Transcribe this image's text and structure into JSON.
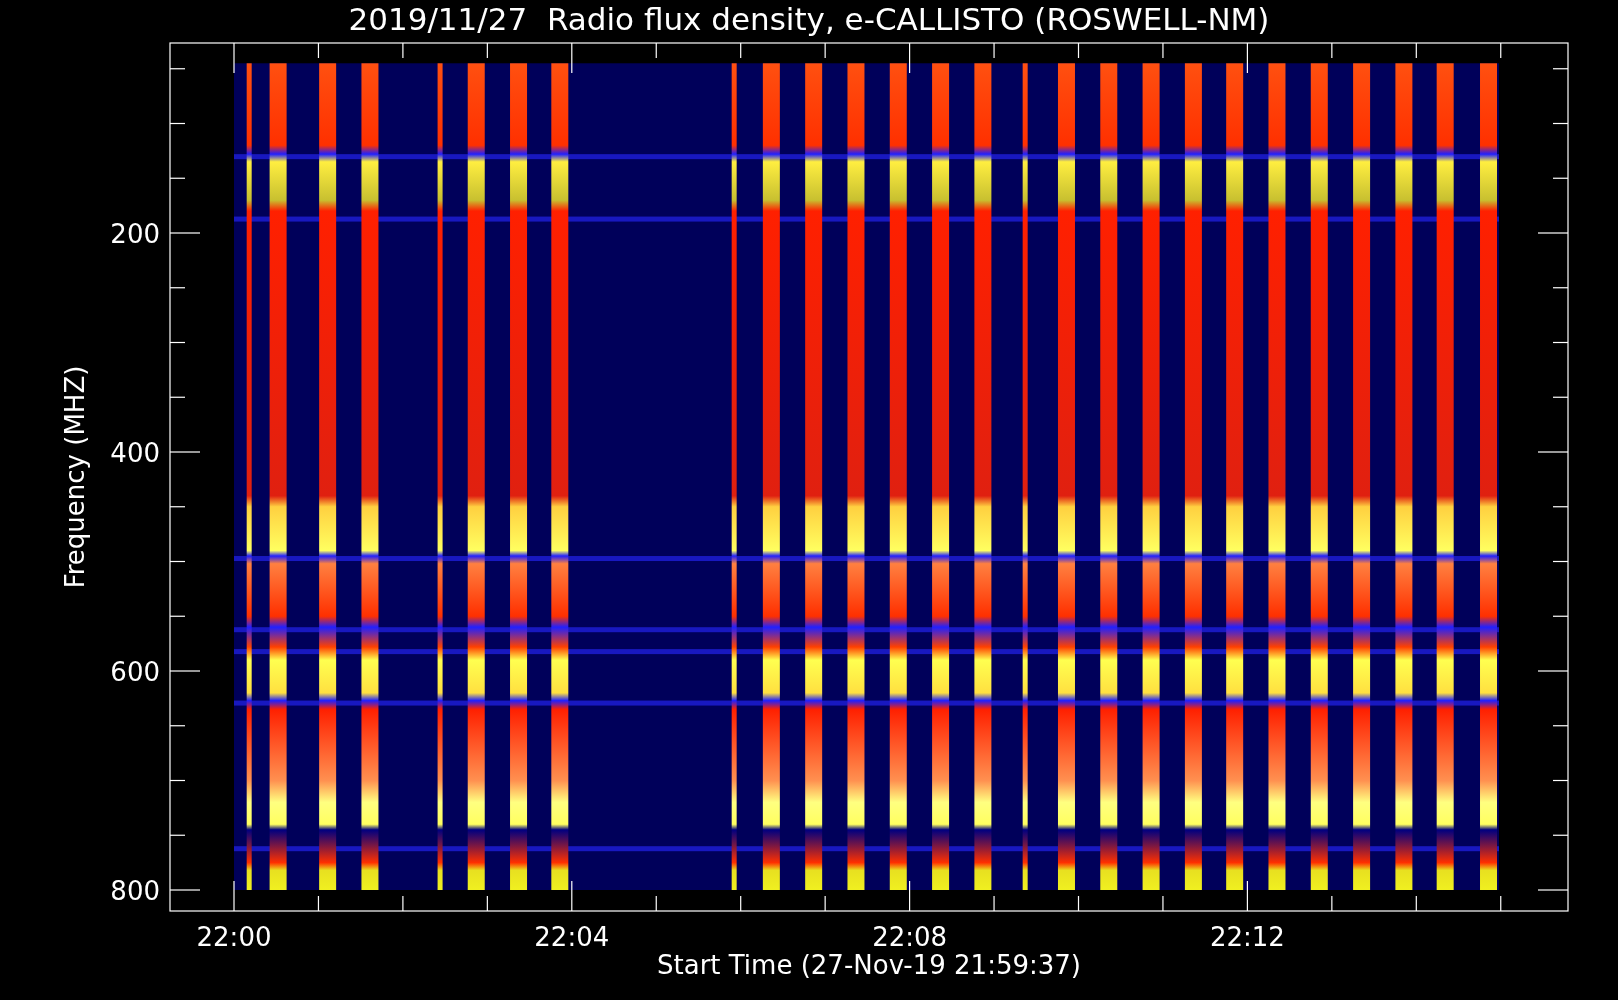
{
  "title": "2019/11/27  Radio flux density, e-CALLISTO (ROSWELL-NM)",
  "plot": {
    "ylabel": "Frequency (MHZ)",
    "xlabel": "Start Time (27-Nov-19 21:59:37)",
    "yticks": [
      "200",
      "400",
      "600",
      "800"
    ],
    "xticks": [
      "22:00",
      "22:04",
      "22:08",
      "22:12"
    ]
  }
}
